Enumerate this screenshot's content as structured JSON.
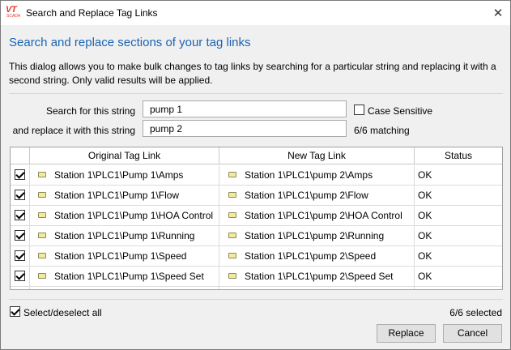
{
  "window": {
    "logo_text": "VT",
    "logo_subtext": "SCADA",
    "title": "Search and Replace Tag Links",
    "close_glyph": "✕"
  },
  "heading": "Search and replace sections of your tag links",
  "description": "This dialog allows you to make bulk changes to tag links by searching for a particular string and replacing it with a second string. Only valid results will be applied.",
  "search": {
    "search_label": "Search for this string",
    "search_value": "pump 1",
    "replace_label": "and replace it with this string",
    "replace_value": "pump 2",
    "case_sensitive_label": "Case Sensitive",
    "case_sensitive_checked": false,
    "matching_text": "6/6 matching"
  },
  "grid": {
    "columns": [
      "",
      "Original Tag Link",
      "New Tag Link",
      "Status"
    ],
    "rows": [
      {
        "checked": true,
        "original": "Station 1\\PLC1\\Pump 1\\Amps",
        "new": "Station 1\\PLC1\\pump 2\\Amps",
        "status": "OK"
      },
      {
        "checked": true,
        "original": "Station 1\\PLC1\\Pump 1\\Flow",
        "new": "Station 1\\PLC1\\pump 2\\Flow",
        "status": "OK"
      },
      {
        "checked": true,
        "original": "Station 1\\PLC1\\Pump 1\\HOA Control",
        "new": "Station 1\\PLC1\\pump 2\\HOA Control",
        "status": "OK"
      },
      {
        "checked": true,
        "original": "Station 1\\PLC1\\Pump 1\\Running",
        "new": "Station 1\\PLC1\\pump 2\\Running",
        "status": "OK"
      },
      {
        "checked": true,
        "original": "Station 1\\PLC1\\Pump 1\\Speed",
        "new": "Station 1\\PLC1\\pump 2\\Speed",
        "status": "OK"
      },
      {
        "checked": true,
        "original": "Station 1\\PLC1\\Pump 1\\Speed Set",
        "new": "Station 1\\PLC1\\pump 2\\Speed Set",
        "status": "OK"
      }
    ],
    "row_icon": "tag-icon"
  },
  "footer": {
    "select_all_label": "Select/deselect all",
    "select_all_checked": true,
    "selected_text": "6/6 selected",
    "replace_button": "Replace",
    "cancel_button": "Cancel"
  },
  "colors": {
    "heading": "#1a64b4",
    "logo": "#e8342c",
    "tag_icon": "#f3ea9a"
  }
}
